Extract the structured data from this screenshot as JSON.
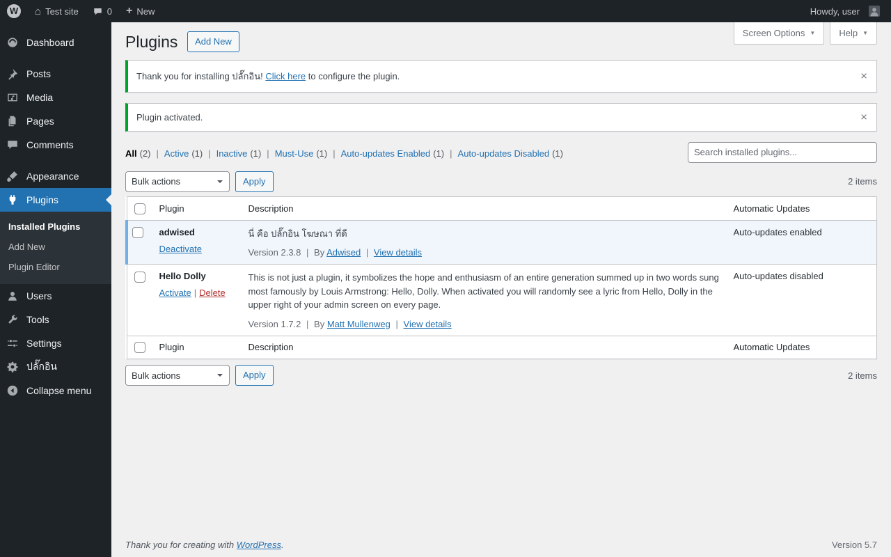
{
  "colors": {
    "accent": "#2271b1",
    "admin_dark": "#1d2327",
    "success_green": "#00a32a",
    "active_row_bg": "#f0f6fc",
    "active_row_border": "#72aee6",
    "delete_red": "#b32d2e"
  },
  "icons": {
    "wp_logo_letter": "W",
    "home": "⌂",
    "plus": "+",
    "dismiss": "×",
    "dropdown_arrow": "▼"
  },
  "misc": {
    "pipe": "|"
  },
  "admin_bar": {
    "site_name": "Test site",
    "comments_count": "0",
    "new_label": "New",
    "howdy": "Howdy, user"
  },
  "sidebar": {
    "items": [
      "Dashboard",
      "Posts",
      "Media",
      "Pages",
      "Comments",
      "Appearance",
      "Plugins",
      "Users",
      "Tools",
      "Settings",
      "ปลั๊กอิน",
      "Collapse menu"
    ],
    "plugins_submenu": [
      "Installed Plugins",
      "Add New",
      "Plugin Editor"
    ]
  },
  "page": {
    "title": "Plugins",
    "add_new_button": "Add New",
    "screen_options": "Screen Options",
    "help": "Help"
  },
  "notices": {
    "install": {
      "prefix": "Thank you for installing ปลั๊กอิน!",
      "link": "Click here",
      "suffix": "to configure the plugin."
    },
    "activated": {
      "text": "Plugin activated."
    }
  },
  "filters": [
    {
      "label": "All",
      "count": "(2)"
    },
    {
      "label": "Active",
      "count": "(1)"
    },
    {
      "label": "Inactive",
      "count": "(1)"
    },
    {
      "label": "Must-Use",
      "count": "(1)"
    },
    {
      "label": "Auto-updates Enabled",
      "count": "(1)"
    },
    {
      "label": "Auto-updates Disabled",
      "count": "(1)"
    }
  ],
  "search": {
    "placeholder": "Search installed plugins..."
  },
  "bulk_actions": {
    "select_label": "Bulk actions",
    "apply_label": "Apply",
    "items_count": "2 items"
  },
  "table": {
    "headers": {
      "plugin": "Plugin",
      "description": "Description",
      "auto_updates": "Automatic Updates"
    },
    "rows": [
      {
        "name": "adwised",
        "deactivate": "Deactivate",
        "description": "นี่ คือ ปลั๊กอิน โฆษณา ที่ดี",
        "version": "Version 2.3.8",
        "by_label": "By",
        "author": "Adwised",
        "view_details": "View details",
        "auto_updates": "Auto-updates enabled"
      },
      {
        "name": "Hello Dolly",
        "activate": "Activate",
        "delete": "Delete",
        "description": "This is not just a plugin, it symbolizes the hope and enthusiasm of an entire generation summed up in two words sung most famously by Louis Armstrong: Hello, Dolly. When activated you will randomly see a lyric from Hello, Dolly in the upper right of your admin screen on every page.",
        "version": "Version 1.7.2",
        "by_label": "By",
        "author": "Matt Mullenweg",
        "view_details": "View details",
        "auto_updates": "Auto-updates disabled"
      }
    ]
  },
  "footer": {
    "thanks_prefix": "Thank you for creating with",
    "wordpress_link": "WordPress",
    "thanks_suffix": ".",
    "version": "Version 5.7"
  }
}
